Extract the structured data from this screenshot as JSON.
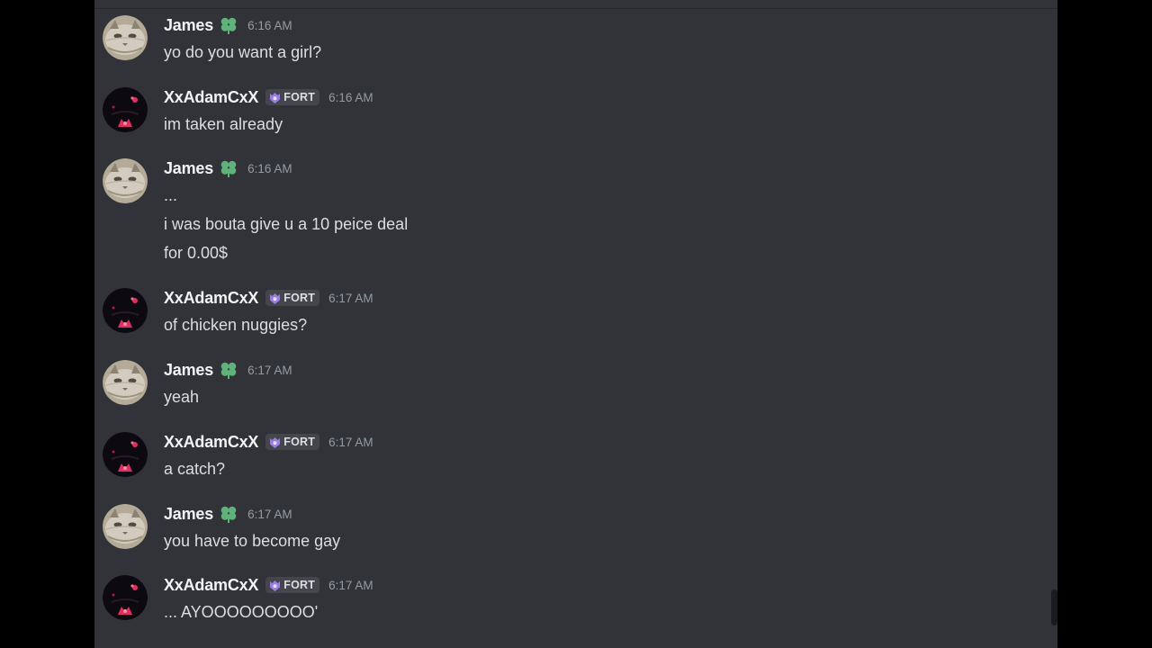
{
  "messages": [
    {
      "author": "James",
      "timestamp": "6:16 AM",
      "lines": [
        "yo do you want a girl?"
      ]
    },
    {
      "author": "XxAdamCxX",
      "tag": "FORT",
      "timestamp": "6:16 AM",
      "lines": [
        "im taken already"
      ]
    },
    {
      "author": "James",
      "timestamp": "6:16 AM",
      "lines": [
        "...",
        "i was bouta give u a 10 peice deal",
        "for 0.00$"
      ]
    },
    {
      "author": "XxAdamCxX",
      "tag": "FORT",
      "timestamp": "6:17 AM",
      "lines": [
        "of chicken nuggies?"
      ]
    },
    {
      "author": "James",
      "timestamp": "6:17 AM",
      "lines": [
        "yeah"
      ]
    },
    {
      "author": "XxAdamCxX",
      "tag": "FORT",
      "timestamp": "6:17 AM",
      "lines": [
        "a catch?"
      ]
    },
    {
      "author": "James",
      "timestamp": "6:17 AM",
      "lines": [
        "you have to become gay"
      ]
    },
    {
      "author": "XxAdamCxX",
      "tag": "FORT",
      "timestamp": "6:17 AM",
      "lines": [
        "... AYOOOOOOOOO'"
      ]
    }
  ],
  "icons": {
    "james_role_icon": "clover-icon",
    "adam_tag_icon": "shield-badge-icon"
  },
  "colors": {
    "chat_background": "#323339",
    "username": "#f2f3f5",
    "message_text": "#dbdee1",
    "timestamp": "#949ba4",
    "clover": "#5eb27a",
    "tag_background": "#45464d",
    "tag_icon": "#9b7fe0"
  }
}
